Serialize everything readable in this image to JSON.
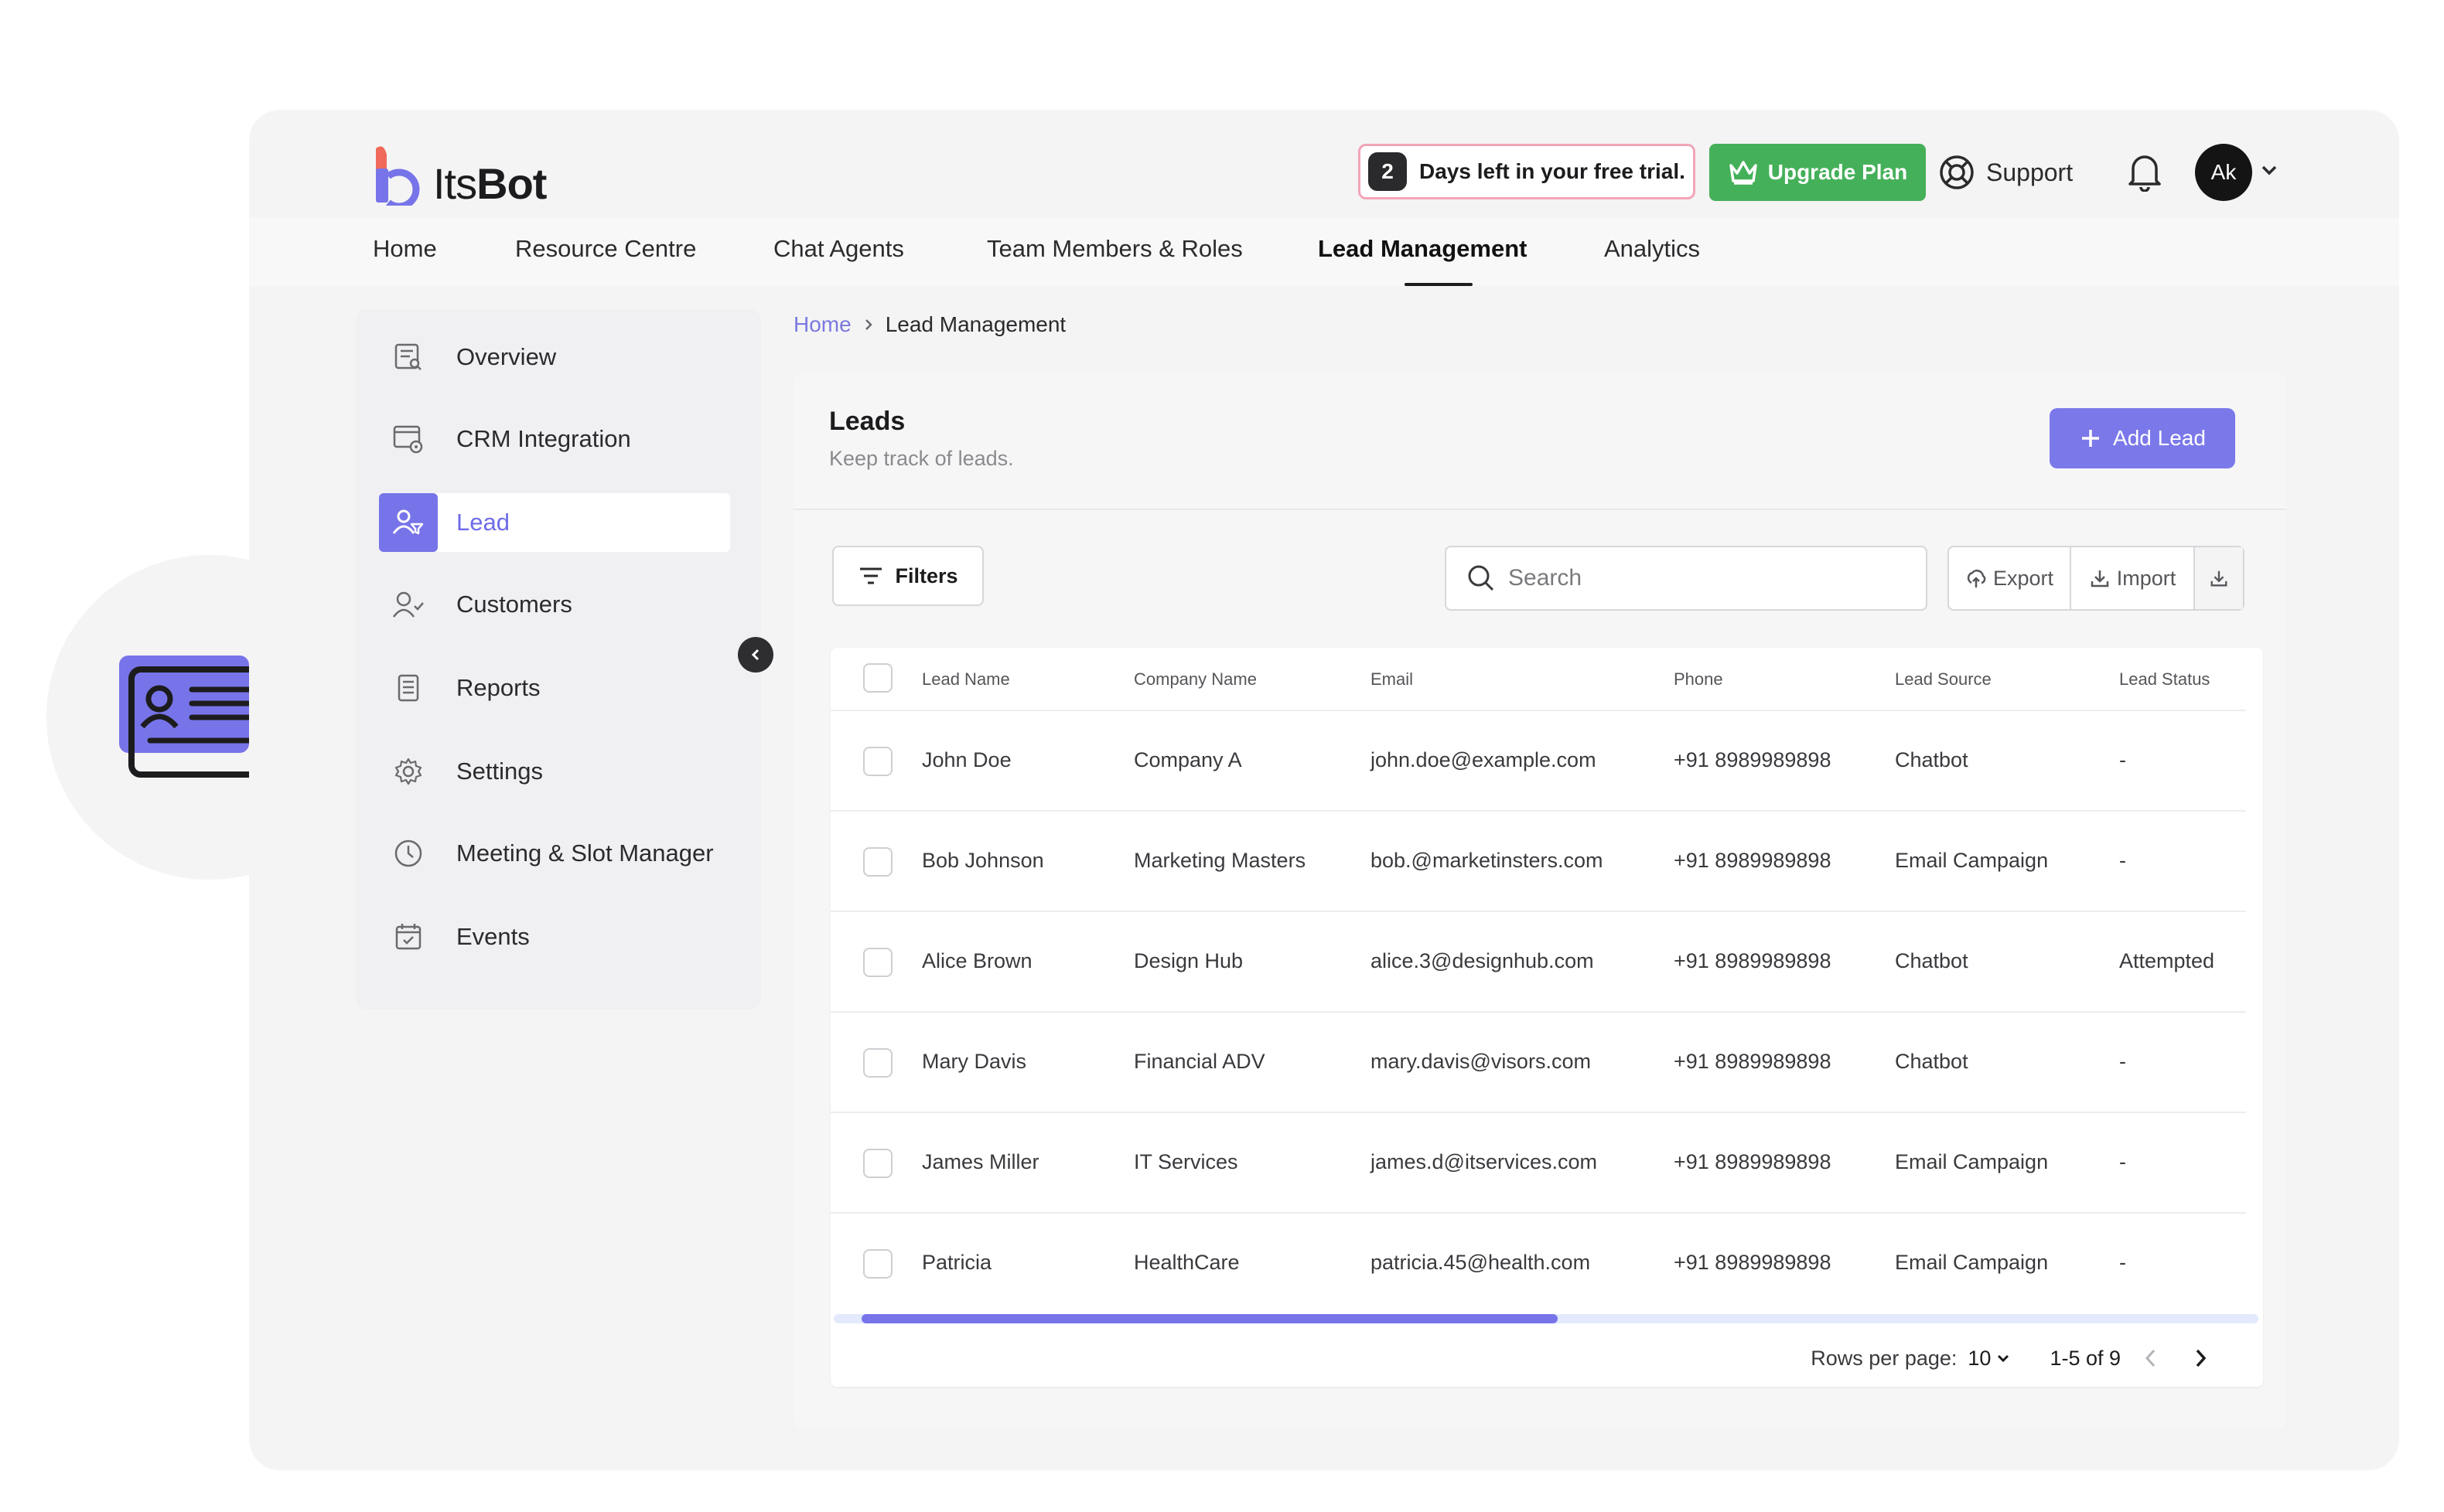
{
  "brand": {
    "name_part1": "Its",
    "name_part2": "Bot"
  },
  "header": {
    "trial_days": "2",
    "trial_text": "Days left in your free trial.",
    "upgrade_label": "Upgrade Plan",
    "support_label": "Support",
    "avatar_initials": "Ak"
  },
  "nav": {
    "items": [
      "Home",
      "Resource Centre",
      "Chat Agents",
      "Team Members & Roles",
      "Lead Management",
      "Analytics"
    ],
    "active": "Lead Management"
  },
  "sidebar": {
    "items": [
      {
        "label": "Overview",
        "icon": "overview-icon"
      },
      {
        "label": "CRM Integration",
        "icon": "crm-settings-icon"
      },
      {
        "label": "Lead",
        "icon": "lead-filter-icon",
        "active": true
      },
      {
        "label": "Customers",
        "icon": "customers-icon"
      },
      {
        "label": "Reports",
        "icon": "reports-icon"
      },
      {
        "label": "Settings",
        "icon": "gear-icon"
      },
      {
        "label": "Meeting & Slot Manager",
        "icon": "clock-icon"
      },
      {
        "label": "Events",
        "icon": "calendar-icon"
      }
    ]
  },
  "breadcrumb": {
    "home": "Home",
    "current": "Lead Management"
  },
  "panel": {
    "title": "Leads",
    "subtitle": "Keep track of leads.",
    "add_label": "Add Lead",
    "filters_label": "Filters",
    "search_placeholder": "Search",
    "export_label": "Export",
    "import_label": "Import"
  },
  "table": {
    "columns": [
      "Lead Name",
      "Company Name",
      "Email",
      "Phone",
      "Lead Source",
      "Lead Status"
    ],
    "rows": [
      [
        "John Doe",
        "Company A",
        "john.doe@example.com",
        "+91 8989989898",
        "Chatbot",
        "-"
      ],
      [
        "Bob Johnson",
        "Marketing Masters",
        "bob.@marketinsters.com",
        "+91 8989989898",
        "Email Campaign",
        "-"
      ],
      [
        "Alice Brown",
        "Design Hub",
        "alice.3@designhub.com",
        "+91 8989989898",
        "Chatbot",
        "Attempted"
      ],
      [
        "Mary Davis",
        "Financial ADV",
        "mary.davis@visors.com",
        "+91 8989989898",
        "Chatbot",
        "-"
      ],
      [
        "James Miller",
        "IT Services",
        "james.d@itservices.com",
        "+91 8989989898",
        "Email Campaign",
        "-"
      ],
      [
        "Patricia",
        "HealthCare",
        "patricia.45@health.com",
        "+91 8989989898",
        "Email Campaign",
        "-"
      ]
    ]
  },
  "pagination": {
    "rows_per_page_label": "Rows per page:",
    "rows_per_page": "10",
    "range": "1-5 of 9"
  },
  "colors": {
    "accent": "#7774e9",
    "upgrade": "#45b05a",
    "trial_border": "#f2a5b7"
  }
}
